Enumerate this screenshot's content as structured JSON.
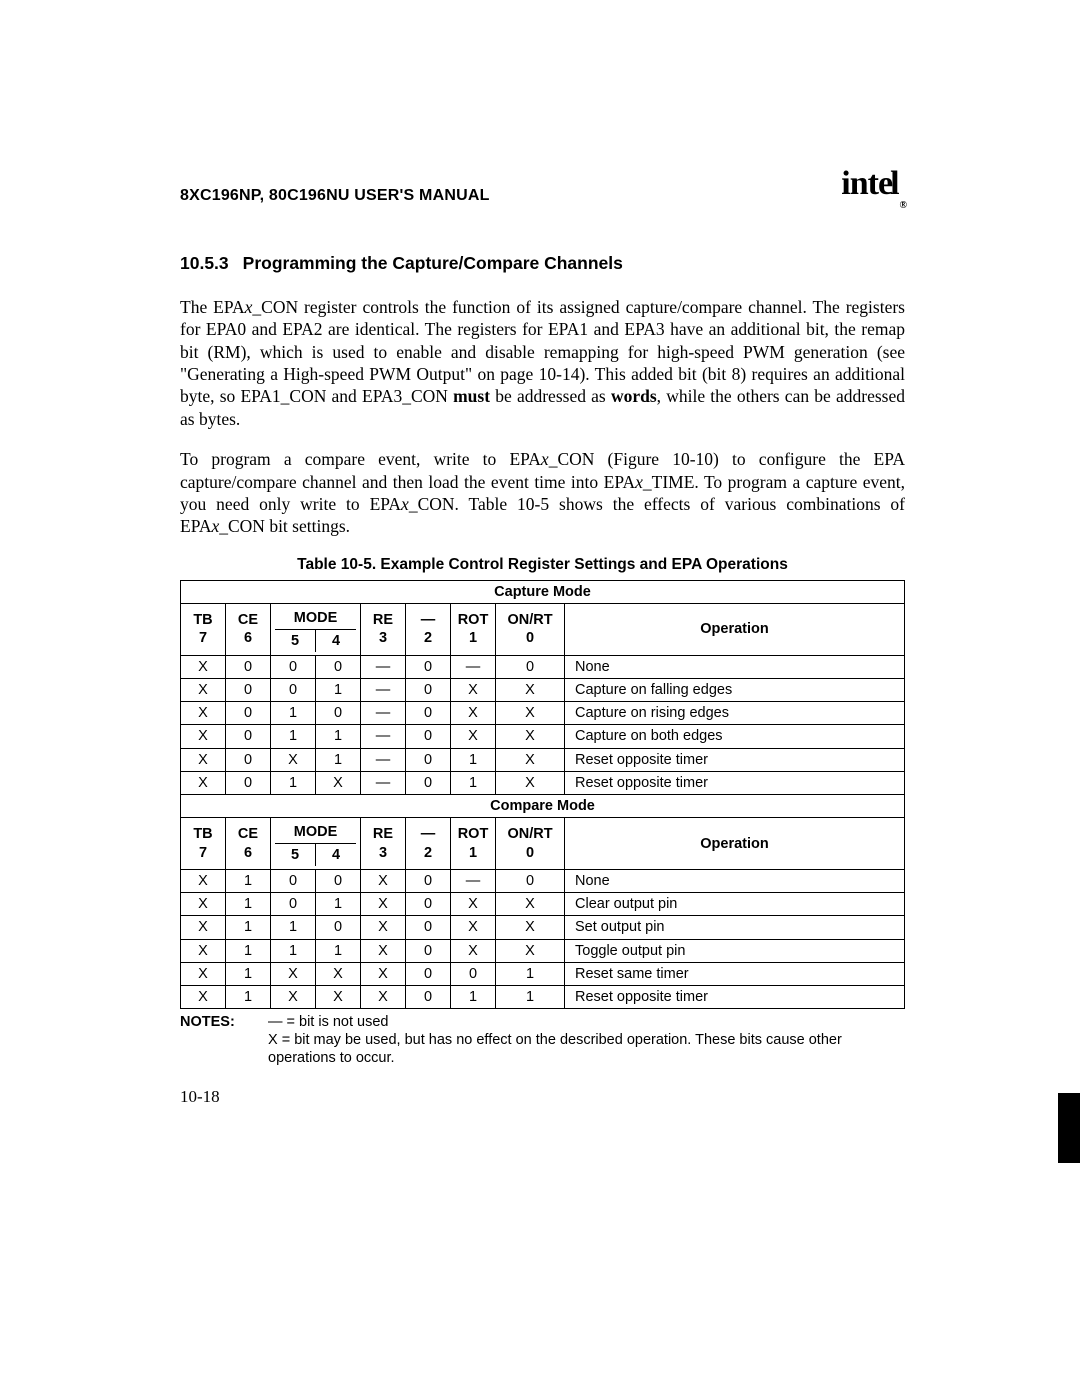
{
  "header": {
    "running_head": "8XC196NP, 80C196NU USER'S MANUAL",
    "brand": "intel",
    "reg": "®"
  },
  "section": {
    "number": "10.5.3",
    "title": "Programming the Capture/Compare Channels"
  },
  "para1_a": "The EPA",
  "para1_b": "_CON register controls the function of its assigned capture/compare channel. The registers for EPA0 and EPA2 are identical. The registers for EPA1 and EPA3 have an additional bit, the remap bit (RM), which is used to enable and disable remapping for high-speed PWM generation (see \"Generating a High-speed PWM Output\" on page 10-14). This added bit (bit 8) requires an additional byte, so EPA1_CON and EPA3_CON ",
  "para1_c": "must",
  "para1_d": " be addressed as ",
  "para1_e": "words",
  "para1_f": ", while the others can be addressed as bytes.",
  "para2_a": "To program a compare event, write to EPA",
  "para2_b": "_CON (Figure 10-10) to configure the EPA capture/compare channel and then load the event time into EPA",
  "para2_c": "_TIME. To program a capture event, you need only write to EPA",
  "para2_d": "_CON. Table 10-5 shows the effects of various combinations of EPA",
  "para2_e": "_CON bit settings.",
  "italic_x": "x",
  "table": {
    "caption": "Table 10-5.  Example Control Register Settings and EPA Operations",
    "capture_label": "Capture Mode",
    "compare_label": "Compare Mode",
    "headers": {
      "tb": "TB",
      "tb_n": "7",
      "ce": "CE",
      "ce_n": "6",
      "mode": "MODE",
      "mode_n5": "5",
      "mode_n4": "4",
      "re": "RE",
      "re_n": "3",
      "dash": "—",
      "dash_n": "2",
      "rot": "ROT",
      "rot_n": "1",
      "onrt": "ON/RT",
      "onrt_n": "0",
      "op": "Operation"
    },
    "capture_rows": [
      {
        "c": [
          "X",
          "0",
          "0",
          "0",
          "—",
          "0",
          "—",
          "0"
        ],
        "op": "None"
      },
      {
        "c": [
          "X",
          "0",
          "0",
          "1",
          "—",
          "0",
          "X",
          "X"
        ],
        "op": "Capture on falling edges"
      },
      {
        "c": [
          "X",
          "0",
          "1",
          "0",
          "—",
          "0",
          "X",
          "X"
        ],
        "op": "Capture on rising edges"
      },
      {
        "c": [
          "X",
          "0",
          "1",
          "1",
          "—",
          "0",
          "X",
          "X"
        ],
        "op": "Capture on both edges"
      },
      {
        "c": [
          "X",
          "0",
          "X",
          "1",
          "—",
          "0",
          "1",
          "X"
        ],
        "op": "Reset opposite timer"
      },
      {
        "c": [
          "X",
          "0",
          "1",
          "X",
          "—",
          "0",
          "1",
          "X"
        ],
        "op": "Reset opposite timer"
      }
    ],
    "compare_rows": [
      {
        "c": [
          "X",
          "1",
          "0",
          "0",
          "X",
          "0",
          "—",
          "0"
        ],
        "op": "None"
      },
      {
        "c": [
          "X",
          "1",
          "0",
          "1",
          "X",
          "0",
          "X",
          "X"
        ],
        "op": "Clear output pin"
      },
      {
        "c": [
          "X",
          "1",
          "1",
          "0",
          "X",
          "0",
          "X",
          "X"
        ],
        "op": "Set output pin"
      },
      {
        "c": [
          "X",
          "1",
          "1",
          "1",
          "X",
          "0",
          "X",
          "X"
        ],
        "op": "Toggle output pin"
      },
      {
        "c": [
          "X",
          "1",
          "X",
          "X",
          "X",
          "0",
          "0",
          "1"
        ],
        "op": "Reset same timer"
      },
      {
        "c": [
          "X",
          "1",
          "X",
          "X",
          "X",
          "0",
          "1",
          "1"
        ],
        "op": "Reset opposite timer"
      }
    ]
  },
  "notes": {
    "label": "NOTES:",
    "line1": "— = bit is not used",
    "line2": "X = bit may be used, but has no effect on the described operation. These bits cause other operations to occur."
  },
  "page_number": "10-18"
}
